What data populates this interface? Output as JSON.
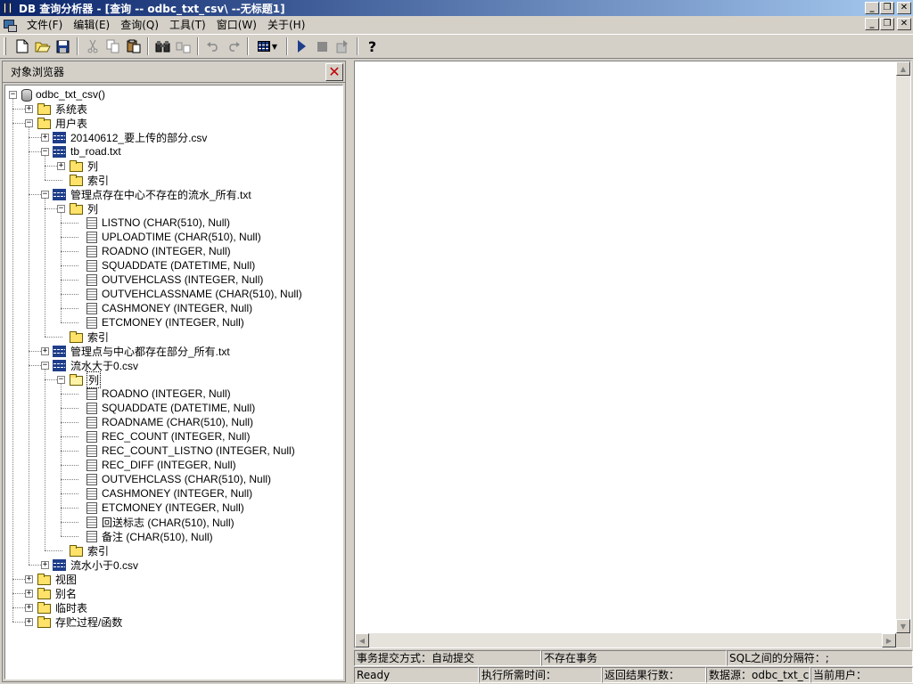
{
  "window": {
    "title": "DB 查询分析器 - [查询 -- odbc_txt_csv\\  --无标题1]"
  },
  "menu": [
    "文件(F)",
    "编辑(E)",
    "查询(Q)",
    "工具(T)",
    "窗口(W)",
    "关于(H)"
  ],
  "toolbar": {
    "buttons": [
      "new-file-icon",
      "open-folder-icon",
      "save-icon",
      "cut-icon",
      "copy-icon",
      "paste-icon",
      "find-icon",
      "replace-icon",
      "undo-icon",
      "redo-icon",
      "results-grid-icon",
      "execute-icon",
      "stop-icon",
      "parse-icon",
      "help-icon"
    ],
    "help_glyph": "?"
  },
  "object_browser": {
    "title": "对象浏览器",
    "close_glyph": "✕",
    "tree": [
      {
        "label": "odbc_txt_csv()",
        "level": 0,
        "icon": "db",
        "expander": "-"
      },
      {
        "label": "系统表",
        "level": 1,
        "icon": "folder",
        "expander": "+"
      },
      {
        "label": "用户表",
        "level": 1,
        "icon": "folder",
        "expander": "-"
      },
      {
        "label": "20140612_要上传的部分.csv",
        "level": 2,
        "icon": "table",
        "expander": "+"
      },
      {
        "label": "tb_road.txt",
        "level": 2,
        "icon": "table",
        "expander": "-"
      },
      {
        "label": "列",
        "level": 3,
        "icon": "folder",
        "expander": "+"
      },
      {
        "label": "索引",
        "level": 3,
        "icon": "folder",
        "expander": ""
      },
      {
        "label": "管理点存在中心不存在的流水_所有.txt",
        "level": 2,
        "icon": "table",
        "expander": "-"
      },
      {
        "label": "列",
        "level": 3,
        "icon": "folder",
        "expander": "-"
      },
      {
        "label": "LISTNO (CHAR(510), Null)",
        "level": 4,
        "icon": "column",
        "expander": ""
      },
      {
        "label": "UPLOADTIME (CHAR(510), Null)",
        "level": 4,
        "icon": "column",
        "expander": ""
      },
      {
        "label": "ROADNO (INTEGER, Null)",
        "level": 4,
        "icon": "column",
        "expander": ""
      },
      {
        "label": "SQUADDATE (DATETIME, Null)",
        "level": 4,
        "icon": "column",
        "expander": ""
      },
      {
        "label": "OUTVEHCLASS (INTEGER, Null)",
        "level": 4,
        "icon": "column",
        "expander": ""
      },
      {
        "label": "OUTVEHCLASSNAME (CHAR(510), Null)",
        "level": 4,
        "icon": "column",
        "expander": ""
      },
      {
        "label": "CASHMONEY (INTEGER, Null)",
        "level": 4,
        "icon": "column",
        "expander": ""
      },
      {
        "label": "ETCMONEY (INTEGER, Null)",
        "level": 4,
        "icon": "column",
        "expander": ""
      },
      {
        "label": "索引",
        "level": 3,
        "icon": "folder",
        "expander": ""
      },
      {
        "label": "管理点与中心都存在部分_所有.txt",
        "level": 2,
        "icon": "table",
        "expander": "+"
      },
      {
        "label": "流水大于0.csv",
        "level": 2,
        "icon": "table",
        "expander": "-"
      },
      {
        "label": "列",
        "level": 3,
        "icon": "folder-open",
        "expander": "-",
        "selected": true
      },
      {
        "label": "ROADNO (INTEGER, Null)",
        "level": 4,
        "icon": "column",
        "expander": ""
      },
      {
        "label": "SQUADDATE (DATETIME, Null)",
        "level": 4,
        "icon": "column",
        "expander": ""
      },
      {
        "label": "ROADNAME (CHAR(510), Null)",
        "level": 4,
        "icon": "column",
        "expander": ""
      },
      {
        "label": "REC_COUNT (INTEGER, Null)",
        "level": 4,
        "icon": "column",
        "expander": ""
      },
      {
        "label": "REC_COUNT_LISTNO (INTEGER, Null)",
        "level": 4,
        "icon": "column",
        "expander": ""
      },
      {
        "label": "REC_DIFF (INTEGER, Null)",
        "level": 4,
        "icon": "column",
        "expander": ""
      },
      {
        "label": "OUTVEHCLASS (CHAR(510), Null)",
        "level": 4,
        "icon": "column",
        "expander": ""
      },
      {
        "label": "CASHMONEY (INTEGER, Null)",
        "level": 4,
        "icon": "column",
        "expander": ""
      },
      {
        "label": "ETCMONEY (INTEGER, Null)",
        "level": 4,
        "icon": "column",
        "expander": ""
      },
      {
        "label": "回送标志 (CHAR(510), Null)",
        "level": 4,
        "icon": "column",
        "expander": ""
      },
      {
        "label": "备注 (CHAR(510), Null)",
        "level": 4,
        "icon": "column",
        "expander": ""
      },
      {
        "label": "索引",
        "level": 3,
        "icon": "folder",
        "expander": ""
      },
      {
        "label": "流水小于0.csv",
        "level": 2,
        "icon": "table",
        "expander": "+"
      },
      {
        "label": "视图",
        "level": 1,
        "icon": "folder",
        "expander": "+"
      },
      {
        "label": "别名",
        "level": 1,
        "icon": "folder",
        "expander": "+"
      },
      {
        "label": "临时表",
        "level": 1,
        "icon": "folder",
        "expander": "+"
      },
      {
        "label": "存贮过程/函数",
        "level": 1,
        "icon": "folder",
        "expander": "+"
      }
    ]
  },
  "status_top": {
    "commit_mode": "事务提交方式：自动提交",
    "transaction": "不存在事务",
    "sql_separator": "SQL之间的分隔符：;"
  },
  "status_bottom": {
    "state": "Ready",
    "exec_time": "执行所需时间：",
    "rows_returned": "返回结果行数：",
    "datasource": "数据源：odbc_txt_csv",
    "current_user": "当前用户："
  }
}
